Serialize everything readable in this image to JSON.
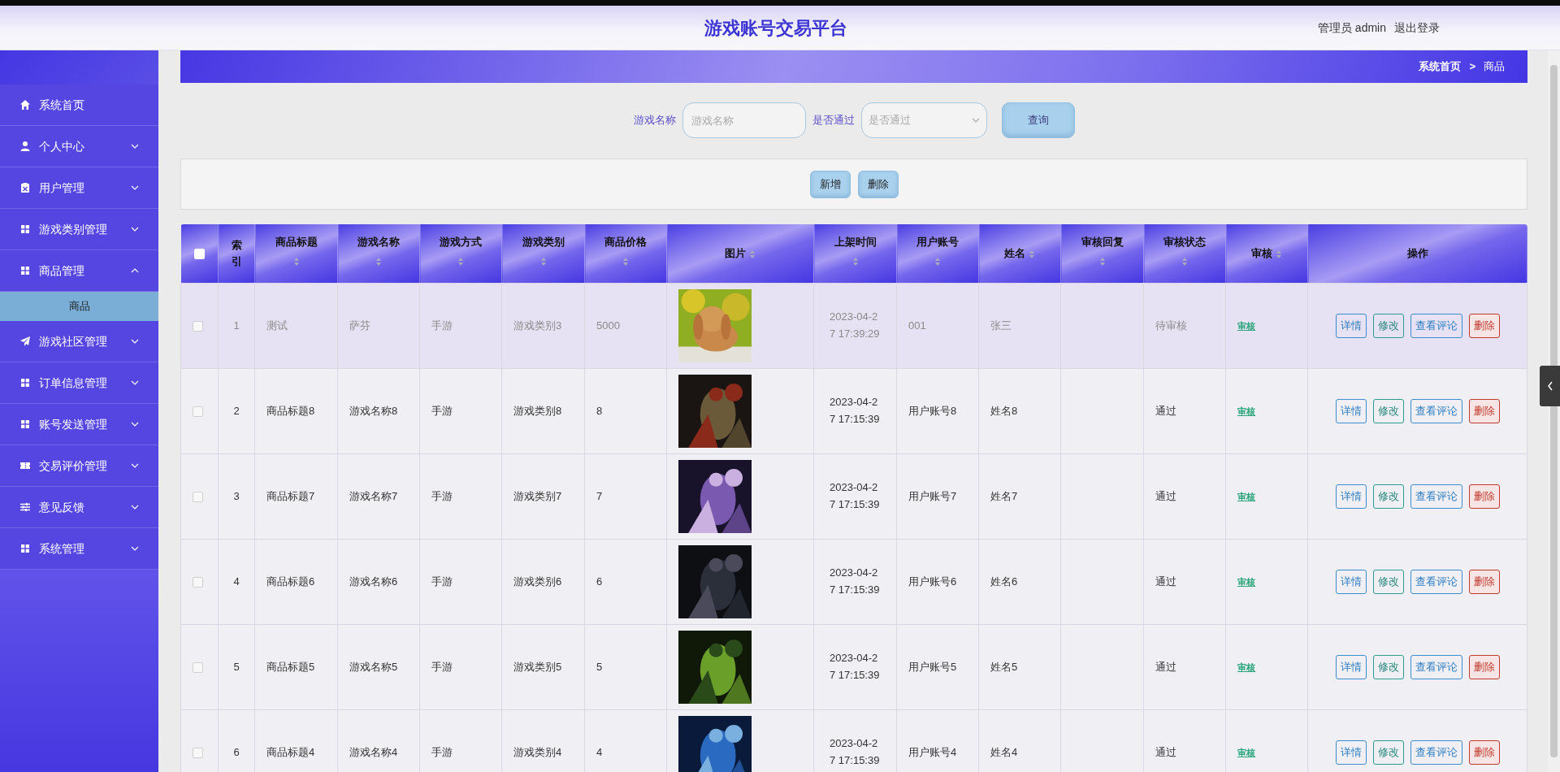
{
  "header": {
    "title": "游戏账号交易平台",
    "user": "管理员 admin",
    "logout": "退出登录"
  },
  "sidebar": {
    "items": [
      {
        "label": "系统首页"
      },
      {
        "label": "个人中心",
        "expanded": false
      },
      {
        "label": "用户管理",
        "expanded": false
      },
      {
        "label": "游戏类别管理",
        "expanded": false
      },
      {
        "label": "商品管理",
        "expanded": true,
        "children": [
          {
            "label": "商品",
            "selected": true
          }
        ]
      },
      {
        "label": "游戏社区管理",
        "expanded": false
      },
      {
        "label": "订单信息管理",
        "expanded": false
      },
      {
        "label": "账号发送管理",
        "expanded": false
      },
      {
        "label": "交易评价管理",
        "expanded": false
      },
      {
        "label": "意见反馈",
        "expanded": false
      },
      {
        "label": "系统管理",
        "expanded": false
      }
    ]
  },
  "breadcrumb": [
    "系统首页",
    ">",
    "商品"
  ],
  "search": {
    "fields": [
      {
        "kind": "input",
        "label": "游戏名称",
        "placeholder": "游戏名称"
      },
      {
        "kind": "select",
        "label": "是否通过",
        "placeholder": "是否通过"
      }
    ],
    "button": "查询"
  },
  "toolbar": [
    "新增",
    "删除"
  ],
  "table": {
    "columns": [
      {
        "kind": "check",
        "checked": false
      },
      {
        "kind": "plain",
        "label": "索引"
      },
      {
        "kind": "stacked",
        "label": "商品标题"
      },
      {
        "kind": "stacked",
        "label": "游戏名称"
      },
      {
        "kind": "stacked",
        "label": "游戏方式"
      },
      {
        "kind": "stacked",
        "label": "游戏类别"
      },
      {
        "kind": "stacked",
        "label": "商品价格"
      },
      {
        "kind": "inline",
        "label": "图片"
      },
      {
        "kind": "stacked",
        "label": "上架时间"
      },
      {
        "kind": "stacked",
        "label": "用户账号"
      },
      {
        "kind": "inline",
        "label": "姓名"
      },
      {
        "kind": "stacked",
        "label": "审核回复"
      },
      {
        "kind": "stacked",
        "label": "审核状态"
      },
      {
        "kind": "inline",
        "label": "审核"
      },
      {
        "kind": "plain",
        "label": "操作"
      }
    ],
    "rows": [
      {
        "highlighted": true,
        "checked": false,
        "index": "1",
        "title": "测试",
        "game": "萨芬",
        "mode": "手游",
        "category": "游戏类别3",
        "price": "5000",
        "listed": "2023-04-27 17:39:29",
        "account": "001",
        "name": "张三",
        "status": "待审核",
        "audit": "审核",
        "actions": [
          {
            "kind": "info",
            "label": "详情"
          },
          {
            "kind": "edit",
            "label": "修改"
          },
          {
            "kind": "info",
            "label": "查看评论"
          },
          {
            "kind": "danger",
            "label": "删除"
          }
        ]
      },
      {
        "highlighted": false,
        "checked": false,
        "index": "2",
        "title": "商品标题8",
        "game": "游戏名称8",
        "mode": "手游",
        "category": "游戏类别8",
        "price": "8",
        "listed": "2023-04-27 17:15:39",
        "account": "用户账号8",
        "name": "姓名8",
        "status": "通过",
        "audit": "审核",
        "actions": [
          {
            "kind": "info",
            "label": "详情"
          },
          {
            "kind": "edit",
            "label": "修改"
          },
          {
            "kind": "info",
            "label": "查看评论"
          },
          {
            "kind": "danger",
            "label": "删除"
          }
        ]
      },
      {
        "highlighted": false,
        "checked": false,
        "index": "3",
        "title": "商品标题7",
        "game": "游戏名称7",
        "mode": "手游",
        "category": "游戏类别7",
        "price": "7",
        "listed": "2023-04-27 17:15:39",
        "account": "用户账号7",
        "name": "姓名7",
        "status": "通过",
        "audit": "审核",
        "actions": [
          {
            "kind": "info",
            "label": "详情"
          },
          {
            "kind": "edit",
            "label": "修改"
          },
          {
            "kind": "info",
            "label": "查看评论"
          },
          {
            "kind": "danger",
            "label": "删除"
          }
        ]
      },
      {
        "highlighted": false,
        "checked": false,
        "index": "4",
        "title": "商品标题6",
        "game": "游戏名称6",
        "mode": "手游",
        "category": "游戏类别6",
        "price": "6",
        "listed": "2023-04-27 17:15:39",
        "account": "用户账号6",
        "name": "姓名6",
        "status": "通过",
        "audit": "审核",
        "actions": [
          {
            "kind": "info",
            "label": "详情"
          },
          {
            "kind": "edit",
            "label": "修改"
          },
          {
            "kind": "info",
            "label": "查看评论"
          },
          {
            "kind": "danger",
            "label": "删除"
          }
        ]
      },
      {
        "highlighted": false,
        "checked": false,
        "index": "5",
        "title": "商品标题5",
        "game": "游戏名称5",
        "mode": "手游",
        "category": "游戏类别5",
        "price": "5",
        "listed": "2023-04-27 17:15:39",
        "account": "用户账号5",
        "name": "姓名5",
        "status": "通过",
        "audit": "审核",
        "actions": [
          {
            "kind": "info",
            "label": "详情"
          },
          {
            "kind": "edit",
            "label": "修改"
          },
          {
            "kind": "info",
            "label": "查看评论"
          },
          {
            "kind": "danger",
            "label": "删除"
          }
        ]
      },
      {
        "highlighted": false,
        "checked": false,
        "index": "6",
        "title": "商品标题4",
        "game": "游戏名称4",
        "mode": "手游",
        "category": "游戏类别4",
        "price": "4",
        "listed": "2023-04-27 17:15:39",
        "account": "用户账号4",
        "name": "姓名4",
        "status": "通过",
        "audit": "审核",
        "actions": [
          {
            "kind": "info",
            "label": "详情"
          },
          {
            "kind": "edit",
            "label": "修改"
          },
          {
            "kind": "info",
            "label": "查看评论"
          },
          {
            "kind": "danger",
            "label": "删除"
          }
        ]
      }
    ]
  }
}
